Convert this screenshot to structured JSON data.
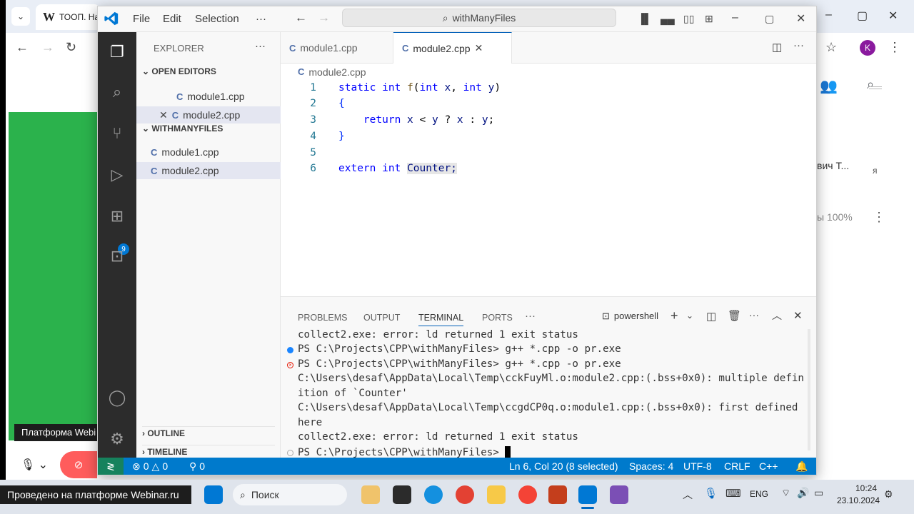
{
  "browser": {
    "tab_label": "ТООП. На",
    "tab_logo": "W",
    "window_controls": [
      "–",
      "▢",
      "✕"
    ],
    "right_fragments": {
      "name": "вич Т...",
      "suffix": "я",
      "percent": "ы 100%"
    }
  },
  "overlay": {
    "platform_label": "Платформа Webi",
    "footer": "Проведено на платформе Webinar.ru"
  },
  "vscode": {
    "menu": {
      "file": "File",
      "edit": "Edit",
      "selection": "Selection",
      "more": "···"
    },
    "search": "withManyFiles",
    "activity_badge": "9",
    "sidebar": {
      "title": "EXPLORER",
      "open_editors_header": "OPEN EDITORS",
      "open_editors": [
        "module1.cpp",
        "module2.cpp"
      ],
      "folder_header": "WITHMANYFILES",
      "folder_files": [
        "module1.cpp",
        "module2.cpp"
      ],
      "outline": "OUTLINE",
      "timeline": "TIMELINE"
    },
    "tabs": [
      {
        "label": "module1.cpp",
        "active": false
      },
      {
        "label": "module2.cpp",
        "active": true
      }
    ],
    "breadcrumb": "module2.cpp",
    "code_lines": [
      {
        "n": "1",
        "text": "static int f(int x, int y)"
      },
      {
        "n": "2",
        "text": "{"
      },
      {
        "n": "3",
        "text": "    return x < y ? x : y;"
      },
      {
        "n": "4",
        "text": "}"
      },
      {
        "n": "5",
        "text": ""
      },
      {
        "n": "6",
        "text": "extern int Counter;"
      }
    ],
    "panel_tabs": [
      "PROBLEMS",
      "OUTPUT",
      "TERMINAL",
      "PORTS",
      "···"
    ],
    "terminal_shell": "powershell",
    "terminal_lines": [
      "collect2.exe: error: ld returned 1 exit status",
      "PS C:\\Projects\\CPP\\withManyFiles> g++ *.cpp -o pr.exe",
      "PS C:\\Projects\\CPP\\withManyFiles> g++ *.cpp -o pr.exe",
      "C:\\Users\\desaf\\AppData\\Local\\Temp\\cckFuyMl.o:module2.cpp:(.bss+0x0): multiple defin",
      "ition of `Counter'",
      "C:\\Users\\desaf\\AppData\\Local\\Temp\\ccgdCP0q.o:module1.cpp:(.bss+0x0): first defined",
      "here",
      "collect2.exe: error: ld returned 1 exit status",
      "PS C:\\Projects\\CPP\\withManyFiles> "
    ],
    "status": {
      "errors": "0",
      "warnings": "0",
      "ports": "0",
      "position": "Ln 6, Col 20 (8 selected)",
      "spaces": "Spaces: 4",
      "encoding": "UTF-8",
      "eol": "CRLF",
      "language": "C++"
    }
  },
  "taskbar": {
    "search": "Поиск",
    "lang": "ENG",
    "time": "10:24",
    "date": "23.10.2024"
  },
  "colors": {
    "accent": "#007acc",
    "activity": "#2c2c2c",
    "green": "#2bb24c"
  }
}
